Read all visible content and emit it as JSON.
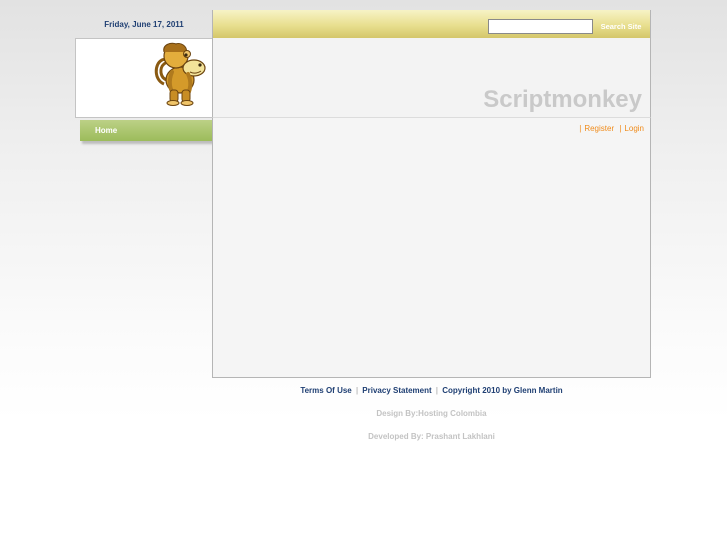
{
  "header": {
    "date": "Friday, June 17, 2011",
    "site_title": "Scriptmonkey",
    "search": {
      "value": "",
      "button_label": "Search Site"
    }
  },
  "nav": {
    "items": [
      {
        "label": "Home"
      }
    ]
  },
  "user_links": {
    "register": "Register",
    "login": "Login",
    "separator": "|"
  },
  "footer": {
    "terms": "Terms Of Use",
    "privacy": "Privacy Statement",
    "copyright": "Copyright 2010 by Glenn Martin",
    "separator": "|",
    "design_by": "Design By:Hosting Colombia",
    "developed_by": "Developed By: Prashant Lakhlani"
  },
  "colors": {
    "accent_bar": "#e8df8f",
    "nav_green": "#9cbc5b",
    "link_orange": "#f08c1c",
    "date_blue": "#1f3f73"
  },
  "icons": {
    "logo": "monkey-logo-icon"
  }
}
